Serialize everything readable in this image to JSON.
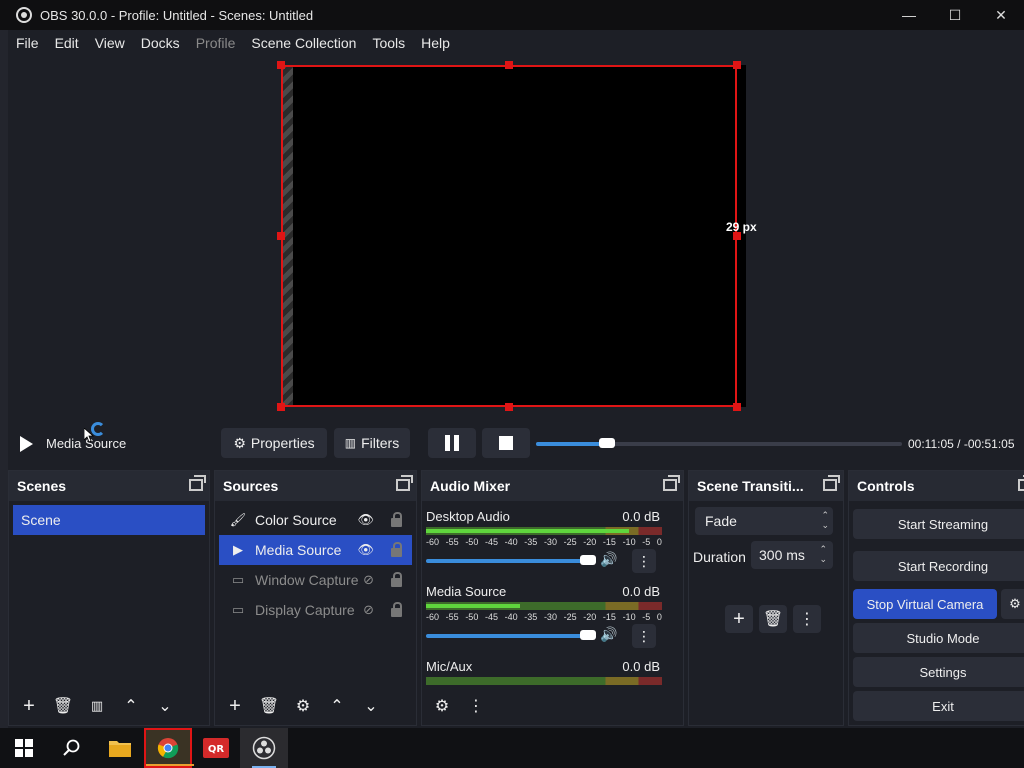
{
  "window": {
    "title": "OBS 30.0.0 - Profile: Untitled - Scenes: Untitled",
    "controls": [
      "—",
      "☐",
      "✕"
    ]
  },
  "menu": [
    "File",
    "Edit",
    "View",
    "Docks",
    "Profile",
    "Scene Collection",
    "Tools",
    "Help"
  ],
  "preview": {
    "size_label": "29 px"
  },
  "media": {
    "source_name": "Media Source",
    "properties_label": "Properties",
    "filters_label": "Filters",
    "time": "00:11:05  /  -00:51:05",
    "progress": 0.18
  },
  "scenes": {
    "title": "Scenes",
    "items": [
      "Scene"
    ]
  },
  "sources": {
    "title": "Sources",
    "items": [
      {
        "name": "Color Source"
      },
      {
        "name": "Media Source"
      },
      {
        "name": "Window Capture"
      },
      {
        "name": "Display Capture"
      }
    ]
  },
  "mixer": {
    "title": "Audio Mixer",
    "channels": [
      {
        "name": "Desktop Audio",
        "db": "0.0 dB",
        "level": 0.86
      },
      {
        "name": "Media Source",
        "db": "0.0 dB",
        "level": 0.4
      },
      {
        "name": "Mic/Aux",
        "db": "0.0 dB",
        "level": 0.0
      }
    ],
    "scale": [
      "-60",
      "-55",
      "-50",
      "-45",
      "-40",
      "-35",
      "-30",
      "-25",
      "-20",
      "-15",
      "-10",
      "-5",
      "0"
    ]
  },
  "transitions": {
    "title": "Scene Transiti...",
    "selected": "Fade",
    "duration_label": "Duration",
    "duration_value": "300 ms"
  },
  "controls": {
    "title": "Controls",
    "start_streaming": "Start Streaming",
    "start_recording": "Start Recording",
    "stop_virtual_camera": "Stop Virtual Camera",
    "studio_mode": "Studio Mode",
    "settings": "Settings",
    "exit": "Exit"
  }
}
